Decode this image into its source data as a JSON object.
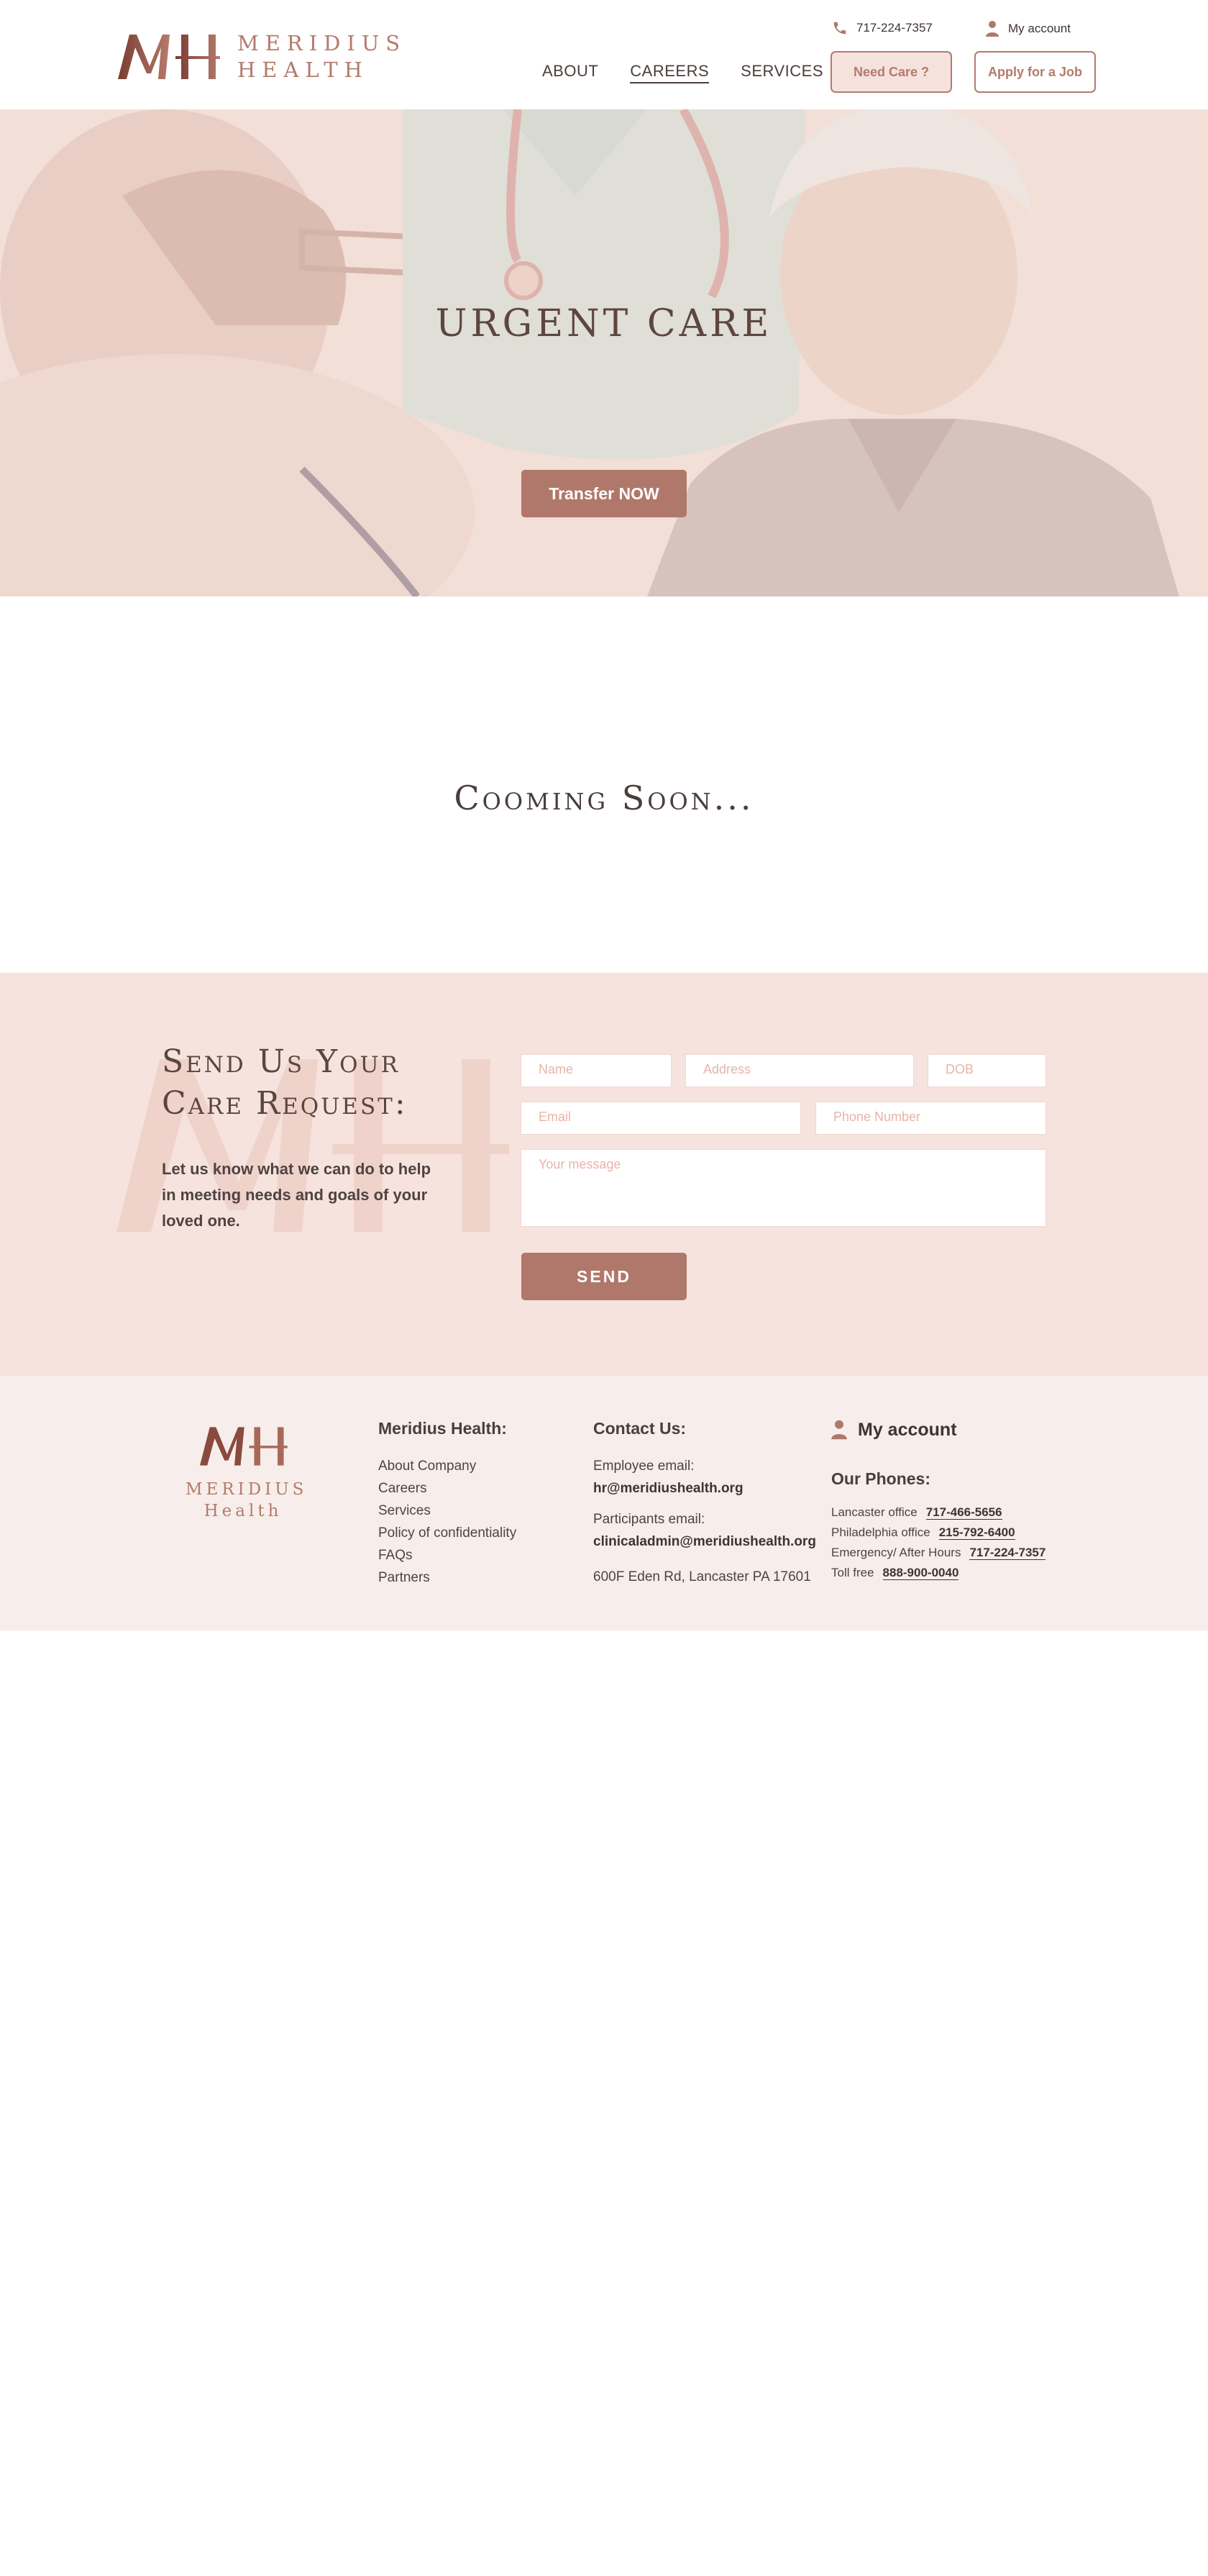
{
  "brand": {
    "name_line1": "MERIDIUS",
    "name_line2": "HEALTH",
    "initials": "MH"
  },
  "header": {
    "phone": "717-224-7357",
    "account": "My account",
    "nav": [
      {
        "label": "ABOUT",
        "active": false
      },
      {
        "label": "CAREERS",
        "active": true
      },
      {
        "label": "SERVICES",
        "active": false
      }
    ],
    "need_care": "Need Care ?",
    "apply_job": "Apply for a Job"
  },
  "hero": {
    "title": "URGENT CARE",
    "cta": "Transfer NOW"
  },
  "main": {
    "coming_soon": "Cooming Soon..."
  },
  "request": {
    "title_line1": "Send Us Your",
    "title_line2": "Care Request:",
    "description": "Let us know what we can do to help in meeting needs and goals of your loved one.",
    "placeholders": {
      "name": "Name",
      "address": "Address",
      "dob": "DOB",
      "email": "Email",
      "phone": "Phone Number",
      "message": "Your message"
    },
    "send": "SEND"
  },
  "footer": {
    "logo_line1": "MERIDIUS",
    "logo_line2": "Health",
    "company_title": "Meridius Health:",
    "links": [
      "About Company",
      "Careers",
      "Services",
      "Policy of confidentiality",
      "FAQs",
      "Partners"
    ],
    "contact_title": "Contact Us:",
    "employee_label": "Employee email:",
    "employee_email": "hr@meridiushealth.org",
    "participants_label": "Participants email:",
    "participants_email": "clinicaladmin@meridiushealth.org",
    "address": "600F Eden Rd, Lancaster PA 17601",
    "account": "My account",
    "phones_title": "Our Phones:",
    "phones": [
      {
        "label": "Lancaster office",
        "number": "717-466-5656"
      },
      {
        "label": "Philadelphia office",
        "number": "215-792-6400"
      },
      {
        "label": "Emergency/ After Hours",
        "number": "717-224-7357"
      },
      {
        "label": "Toll free",
        "number": "888-900-0040"
      }
    ]
  },
  "colors": {
    "accent": "#b0786a",
    "brand": "#b57a6c",
    "section_bg": "#f6e3de",
    "footer_bg": "#f7eeeb"
  }
}
